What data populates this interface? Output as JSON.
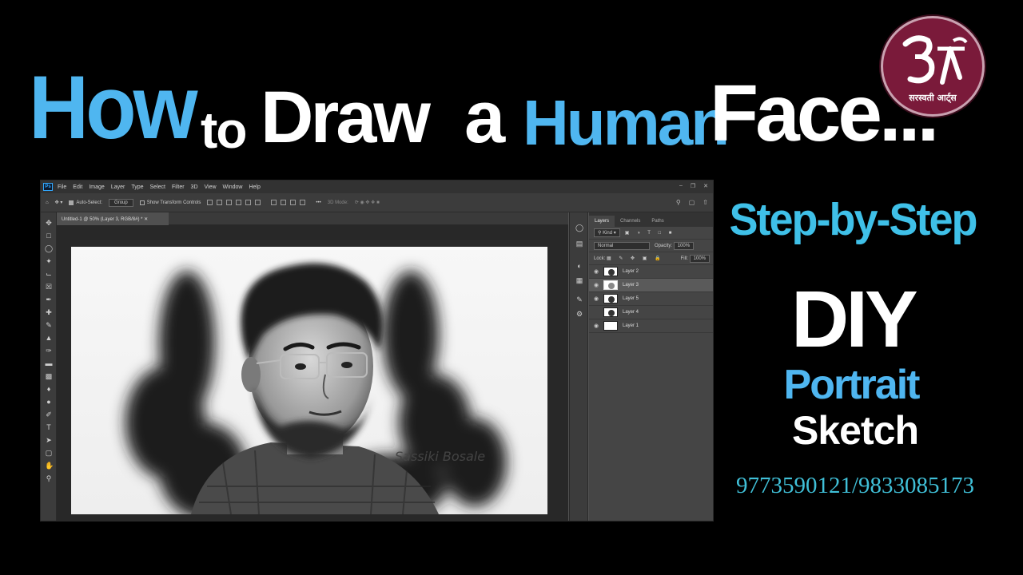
{
  "headline": {
    "how": "How",
    "to": "to",
    "draw": "Draw",
    "a": "a",
    "human": "Human",
    "face": "Face..."
  },
  "logo": {
    "text": "सरस्वती आर्ट्स"
  },
  "right": {
    "step": "Step-by-Step",
    "diy": "DIY",
    "portrait": "Portrait",
    "sketch": "Sketch",
    "phone": "9773590121/9833085173"
  },
  "colors": {
    "accent_blue": "#4fb6f0",
    "logo_bg": "#7a1a3a",
    "phone_teal": "#40c0d8"
  },
  "photoshop": {
    "menus": [
      "File",
      "Edit",
      "Image",
      "Layer",
      "Type",
      "Select",
      "Filter",
      "3D",
      "View",
      "Window",
      "Help"
    ],
    "options": {
      "auto_select": "Auto-Select:",
      "group": "Group",
      "show_transform": "Show Transform Controls",
      "mode_3d": "3D Mode:"
    },
    "doc_tab": "Untitled-1 @ 50% (Layer 3, RGB/8#) *",
    "panel_tabs": [
      "Layers",
      "Channels",
      "Paths"
    ],
    "kind": "Kind",
    "blend": "Normal",
    "opacity_label": "Opacity:",
    "opacity": "100%",
    "lock_label": "Lock:",
    "fill_label": "Fill:",
    "fill": "100%",
    "layers": [
      {
        "name": "Layer 2",
        "visible": true,
        "selected": false
      },
      {
        "name": "Layer 3",
        "visible": true,
        "selected": true
      },
      {
        "name": "Layer 5",
        "visible": true,
        "selected": false
      },
      {
        "name": "Layer 4",
        "visible": false,
        "selected": false
      },
      {
        "name": "Layer 1",
        "visible": true,
        "selected": false
      }
    ],
    "signature": "Sassiki Bosale"
  }
}
